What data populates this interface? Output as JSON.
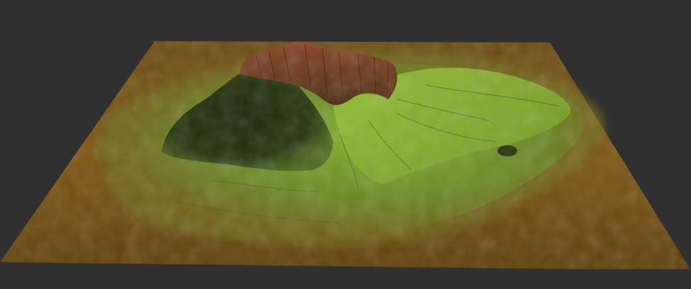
{
  "viewport": {
    "background_color": "#303030",
    "content": "3d-terrain-render"
  },
  "terrain": {
    "colors": {
      "lowland": "#7a5210",
      "lowland_dark": "#5a3c08",
      "vegetation": "#6f9a22",
      "vegetation_bright": "#8fbf2a",
      "vegetation_dark": "#2f4010",
      "shadow": "#1c2a08",
      "summit": "#7a3a1c",
      "summit_dark": "#4a2210"
    }
  }
}
